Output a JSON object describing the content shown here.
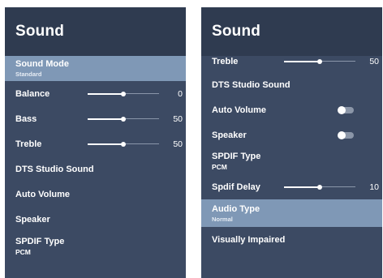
{
  "left_panel": {
    "title": "Sound",
    "items": [
      {
        "label": "Sound Mode",
        "sub": "Standard",
        "selected": true
      },
      {
        "label": "Balance",
        "value": "0",
        "level": 0.5
      },
      {
        "label": "Bass",
        "value": "50",
        "level": 0.5
      },
      {
        "label": "Treble",
        "value": "50",
        "level": 0.5
      },
      {
        "label": "DTS Studio Sound"
      },
      {
        "label": "Auto Volume"
      },
      {
        "label": "Speaker"
      },
      {
        "label": "SPDIF Type",
        "sub": "PCM"
      }
    ]
  },
  "right_panel": {
    "title": "Sound",
    "items": [
      {
        "label": "Treble",
        "value": "50",
        "level": 0.5
      },
      {
        "label": "DTS Studio Sound"
      },
      {
        "label": "Auto Volume",
        "toggle": "off"
      },
      {
        "label": "Speaker",
        "toggle": "off"
      },
      {
        "label": "SPDIF Type",
        "sub": "PCM"
      },
      {
        "label": "Spdif Delay",
        "value": "10",
        "level": 0.5
      },
      {
        "label": "Audio Type",
        "sub": "Normal",
        "selected": true
      },
      {
        "label": "Visually Impaired"
      }
    ]
  }
}
